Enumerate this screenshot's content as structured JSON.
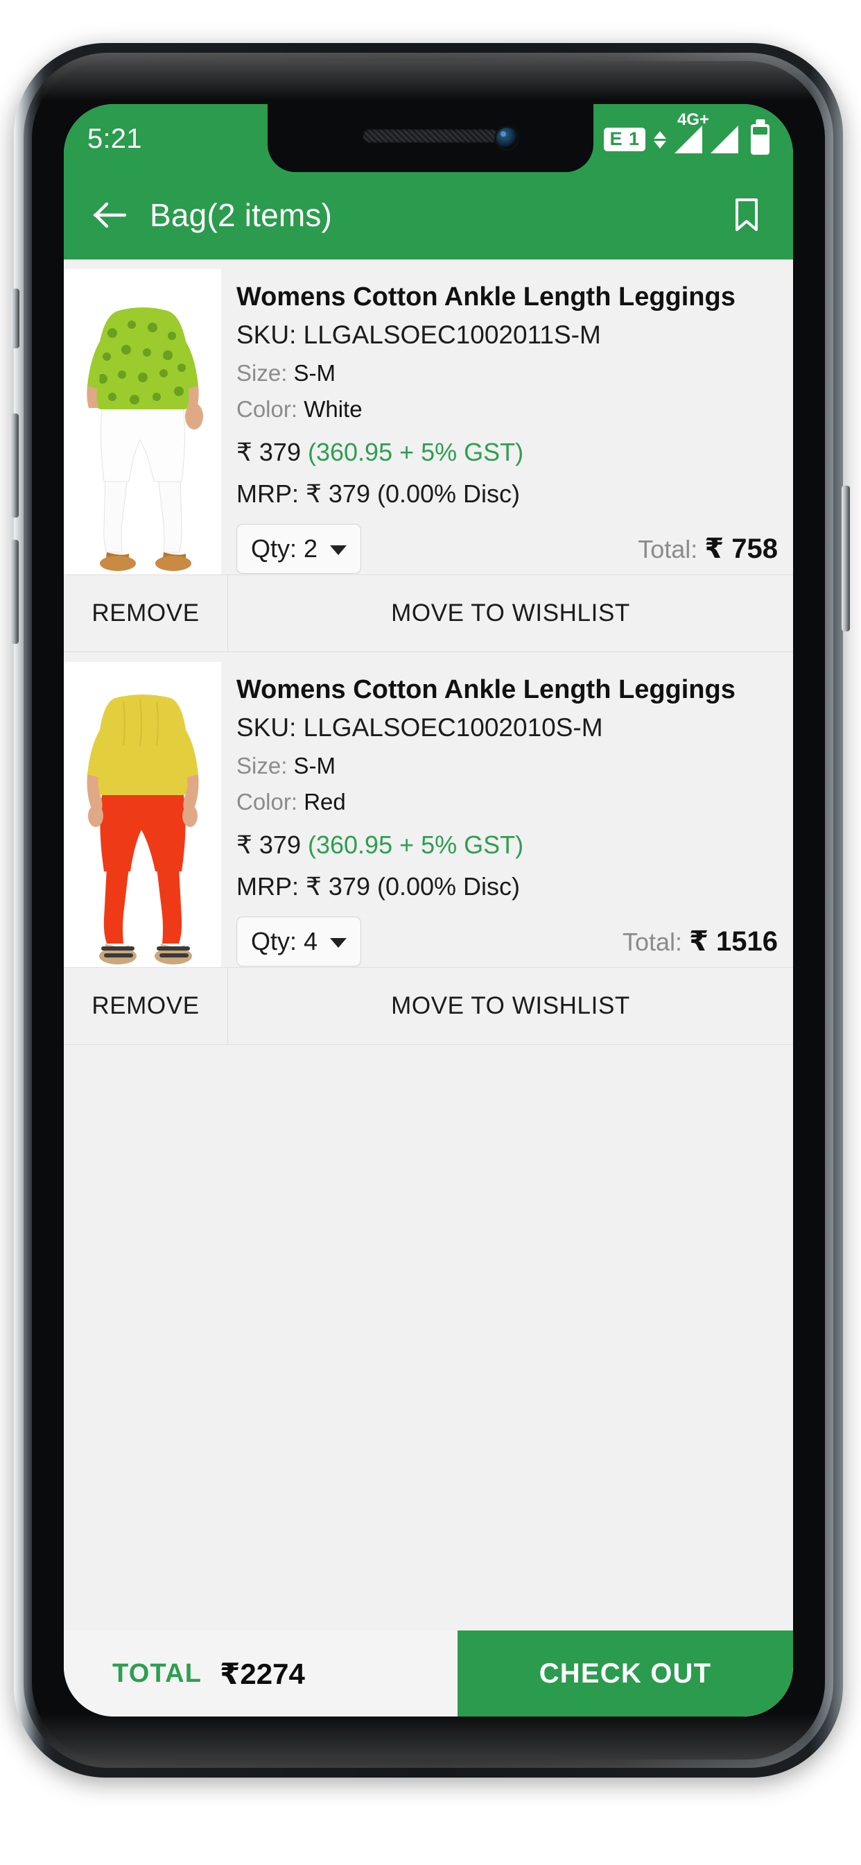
{
  "statusbar": {
    "time": "5:21",
    "sim_badge": "E 1",
    "network": "4G+",
    "icons": [
      "data-transfer-arrows-icon",
      "signal-bars-icon",
      "signal-bars-icon",
      "battery-icon"
    ]
  },
  "appbar": {
    "back_icon": "arrow-left-icon",
    "title": "Bag(2 items)",
    "bookmark_icon": "bookmark-icon",
    "bg_color": "#2b9b4e"
  },
  "cart": {
    "items": [
      {
        "title": "Womens Cotton Ankle Length Leggings",
        "sku": "SKU: LLGALSOEC1002011S-M",
        "size_label": "Size:",
        "size_value": "S-M",
        "color_label": "Color:",
        "color_value": "White",
        "price": "₹ 379",
        "gst": "(360.95 + 5% GST)",
        "mrp": "MRP: ₹ 379 (0.00% Disc)",
        "qty_label": "Qty: 2",
        "total_label": "Total:",
        "total_value": "₹ 758",
        "remove_label": "REMOVE",
        "wishlist_label": "MOVE TO WISHLIST",
        "image": {
          "top_color": "#9ccb2e",
          "legging_color": "#fdfdfd"
        }
      },
      {
        "title": "Womens Cotton Ankle Length Leggings",
        "sku": "SKU: LLGALSOEC1002010S-M",
        "size_label": "Size:",
        "size_value": "S-M",
        "color_label": "Color:",
        "color_value": "Red",
        "price": "₹ 379",
        "gst": "(360.95 + 5% GST)",
        "mrp": "MRP: ₹ 379 (0.00% Disc)",
        "qty_label": "Qty: 4",
        "total_label": "Total:",
        "total_value": "₹ 1516",
        "remove_label": "REMOVE",
        "wishlist_label": "MOVE TO WISHLIST",
        "image": {
          "top_color": "#e3cf3e",
          "legging_color": "#ef3a18"
        }
      }
    ]
  },
  "bottom": {
    "total_word": "TOTAL",
    "total_amount": "₹2274",
    "checkout_label": "CHECK OUT",
    "accent_color": "#2b9b4e"
  }
}
